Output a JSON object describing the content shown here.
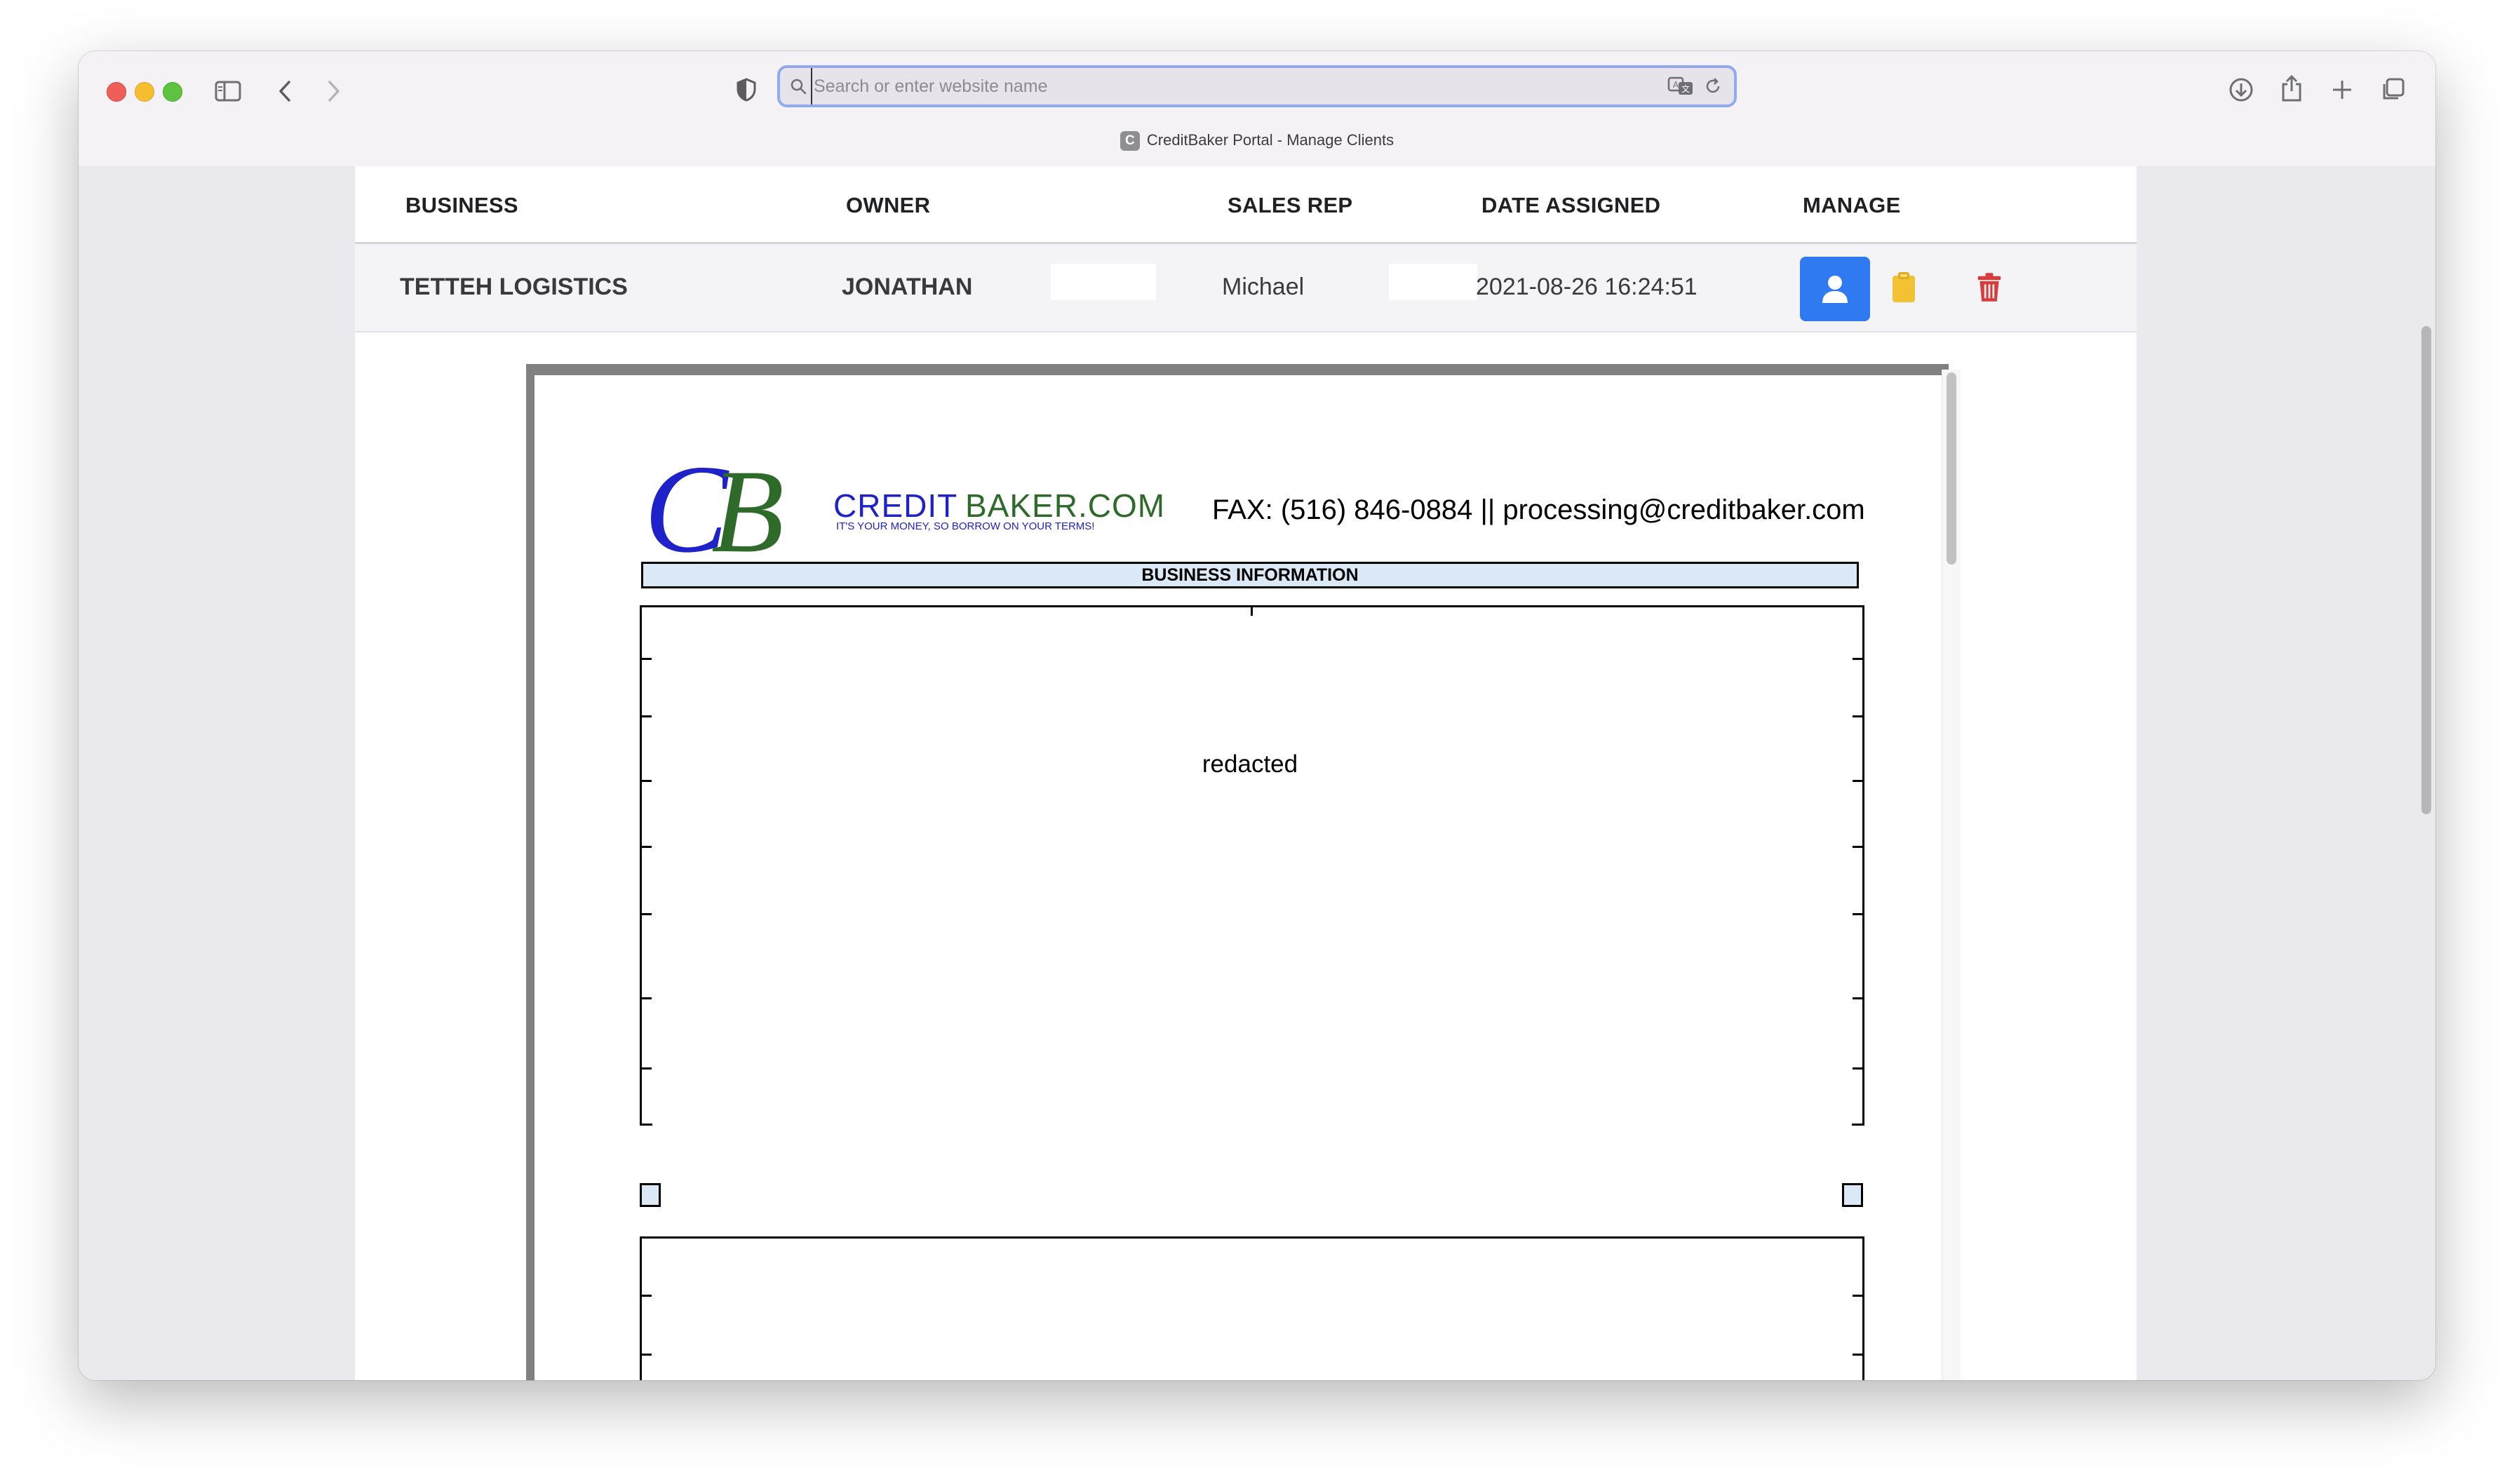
{
  "browser": {
    "address_placeholder": "Search or enter website name",
    "tab_title": "CreditBaker Portal - Manage Clients",
    "favicon_letter": "C"
  },
  "table": {
    "headers": [
      "BUSINESS",
      "OWNER",
      "SALES REP",
      "DATE ASSIGNED",
      "MANAGE"
    ],
    "row": {
      "business": "TETTEH LOGISTICS",
      "owner": "JONATHAN",
      "sales_rep": "Michael",
      "date_assigned": "2021-08-26 16:24:51"
    },
    "colors": {
      "user_button": "#2f7af0",
      "clipboard_icon": "#f2c233",
      "trash_icon": "#d93a3a"
    }
  },
  "document": {
    "logo_mark": "CB",
    "logo_text": "CREDITBAKER.COM",
    "logo_tagline": "IT'S YOUR MONEY, SO BORROW ON YOUR TERMS!",
    "contact": "FAX: (516) 846-0884 || processing@creditbaker.com",
    "section_title": "BUSINESS INFORMATION",
    "redacted_label": "redacted",
    "brand_colors": {
      "blue": "#1f22c8",
      "green": "#2e6b2a"
    }
  }
}
